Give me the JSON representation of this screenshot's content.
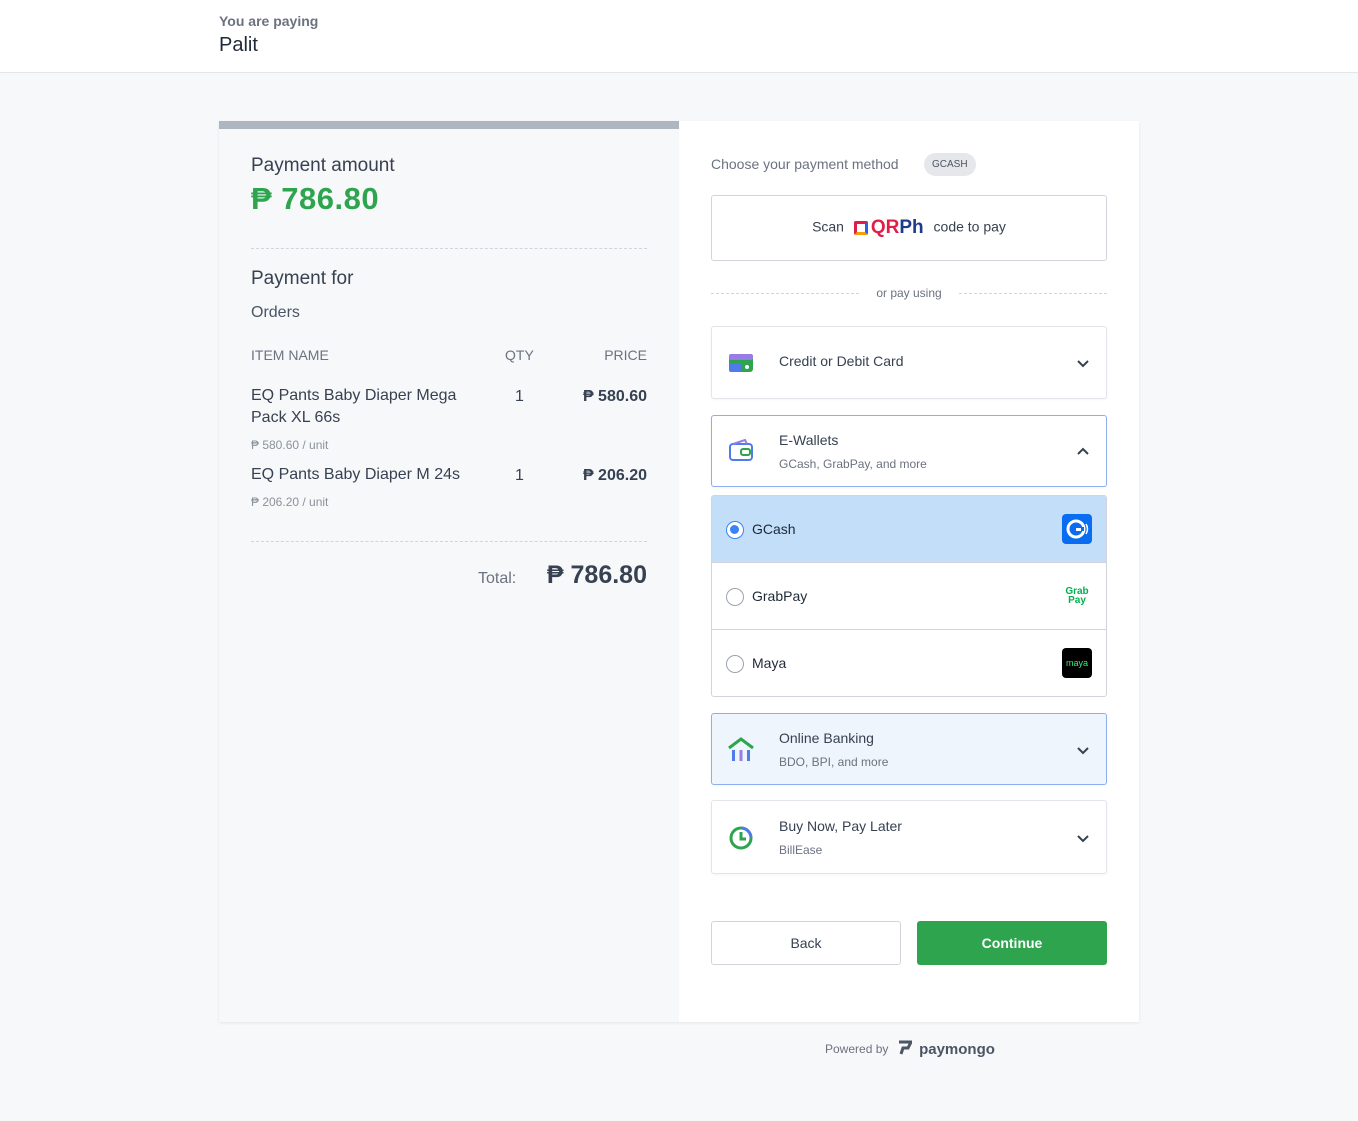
{
  "header": {
    "subtitle": "You are paying",
    "merchant": "Palit"
  },
  "summary": {
    "payment_amount_label": "Payment amount",
    "payment_amount": "₱ 786.80",
    "payment_for_label": "Payment for",
    "payment_for": "Orders",
    "columns": {
      "name": "ITEM NAME",
      "qty": "QTY",
      "price": "PRICE"
    },
    "items": [
      {
        "name": "EQ Pants Baby Diaper Mega Pack XL 66s",
        "qty": "1",
        "price": "₱ 580.60",
        "unit": "₱ 580.60 / unit"
      },
      {
        "name": "EQ Pants Baby Diaper M 24s",
        "qty": "1",
        "price": "₱ 206.20",
        "unit": "₱ 206.20 / unit"
      }
    ],
    "total_label": "Total:",
    "total": "₱ 786.80"
  },
  "payment": {
    "choose_label": "Choose your payment method",
    "badge": "GCASH",
    "qr": {
      "prefix": "Scan",
      "qr": "QR",
      "ph": "Ph",
      "suffix": "code to pay"
    },
    "or_text": "or pay using",
    "methods": [
      {
        "title": "Credit or Debit Card",
        "sub": "",
        "icon": "card-icon",
        "expanded": false
      },
      {
        "title": "E-Wallets",
        "sub": "GCash, GrabPay, and more",
        "icon": "wallet-icon",
        "expanded": true
      },
      {
        "title": "Online Banking",
        "sub": "BDO, BPI, and more",
        "icon": "bank-icon",
        "expanded": false
      },
      {
        "title": "Buy Now, Pay Later",
        "sub": "BillEase",
        "icon": "clock-icon",
        "expanded": false
      }
    ],
    "wallets": [
      {
        "name": "GCash",
        "selected": true,
        "logo_text": "G"
      },
      {
        "name": "GrabPay",
        "selected": false,
        "logo_text": "Grab Pay"
      },
      {
        "name": "Maya",
        "selected": false,
        "logo_text": "maya"
      }
    ],
    "back_label": "Back",
    "continue_label": "Continue"
  },
  "footer": {
    "powered_by": "Powered by",
    "brand": "paymongo"
  },
  "colors": {
    "accent_green": "#2ea44f",
    "selected_blue": "#c2def8",
    "gcash_blue": "#0a6cf1",
    "grab_green": "#00b14f",
    "maya_bg": "#000000",
    "maya_green": "#2ef27a"
  }
}
